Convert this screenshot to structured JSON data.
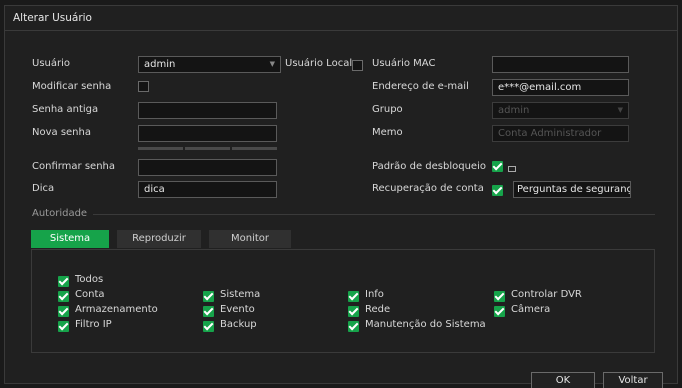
{
  "window": {
    "title": "Alterar Usuário"
  },
  "form": {
    "user_label": "Usuário",
    "user_value": "admin",
    "local_user_label": "Usuário Local",
    "modify_password_label": "Modificar senha",
    "old_password_label": "Senha antiga",
    "new_password_label": "Nova senha",
    "confirm_password_label": "Confirmar senha",
    "hint_label": "Dica",
    "hint_value": "dica",
    "mac_label": "Usuário MAC",
    "mac_value": "",
    "email_label": "Endereço de e-mail",
    "email_value": "e***@email.com",
    "group_label": "Grupo",
    "group_value": "admin",
    "memo_label": "Memo",
    "memo_value": "Conta Administrador",
    "unlock_pattern_label": "Padrão de desbloqueio",
    "recovery_label": "Recuperação de conta",
    "recovery_value": "Perguntas de segurança"
  },
  "authority": {
    "section_label": "Autoridade",
    "tabs": [
      {
        "label": "Sistema",
        "active": true
      },
      {
        "label": "Reproduzir",
        "active": false
      },
      {
        "label": "Monitor",
        "active": false
      }
    ],
    "all_label": "Todos",
    "permissions": [
      "Conta",
      "Sistema",
      "Info",
      "Controlar DVR",
      "Armazenamento",
      "Evento",
      "Rede",
      "Câmera",
      "Filtro IP",
      "Backup",
      "Manutenção do Sistema"
    ]
  },
  "buttons": {
    "ok": "OK",
    "back": "Voltar"
  },
  "colors": {
    "accent": "#16a34a",
    "background": "#202020"
  }
}
